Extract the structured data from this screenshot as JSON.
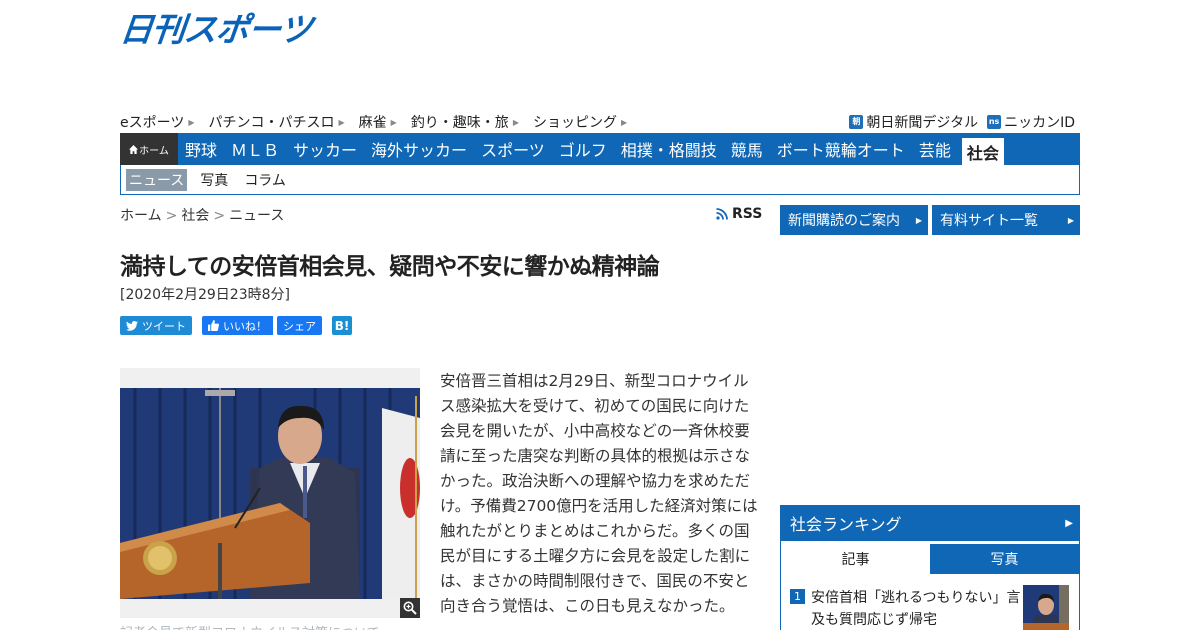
{
  "site": {
    "logo_text": "日刊スポーツ"
  },
  "sublinks": [
    "eスポーツ",
    "パチンコ・パチスロ",
    "麻雀",
    "釣り・趣味・旅",
    "ショッピング"
  ],
  "extlinks": [
    {
      "icon": "朝",
      "label": "朝日新聞デジタル"
    },
    {
      "icon": "ns",
      "label": "ニッカンID"
    }
  ],
  "mainnav": {
    "home_label": "ホーム",
    "items": [
      "野球",
      "ＭＬＢ",
      "サッカー",
      "海外サッカー",
      "スポーツ",
      "ゴルフ",
      "相撲・格闘技",
      "競馬",
      "ボート競輪オート",
      "芸能",
      "社会"
    ],
    "active": "社会"
  },
  "subnav": {
    "items": [
      "ニュース",
      "写真",
      "コラム"
    ],
    "active": "ニュース"
  },
  "breadcrumb": {
    "home": "ホーム",
    "section": "社会",
    "current": "ニュース",
    "sep": ">"
  },
  "rss_label": "RSS",
  "article": {
    "headline": "満持しての安倍首相会見、疑問や不安に響かぬ精神論",
    "date": "[2020年2月29日23時8分]",
    "caption": "記者会見で新型コロナウイルス対策について",
    "body": "安倍晋三首相は2月29日、新型コロナウイルス感染拡大を受けて、初めての国民に向けた会見を開いたが、小中高校などの一斉休校要請に至った唐突な判断の具体的根拠は示さなかった。政治決断への理解や協力を求めただけ。予備費2700億円を活用した経済対策には触れたがとりまとめはこれからだ。多くの国民が目にする土曜夕方に会見を設定した割には、まさかの時間制限付きで、国民の不安と向き合う覚悟は、この日も見えなかった。"
  },
  "share": {
    "tweet": "ツイート",
    "like": "いいね！",
    "share": "シェア",
    "hatena": "B!"
  },
  "sidebar": {
    "subscribe": "新聞購読のご案内",
    "paid_sites": "有料サイト一覧",
    "ranking_title": "社会ランキング",
    "tabs": [
      "記事",
      "写真"
    ],
    "ranking": [
      {
        "rank": "1",
        "title": "安倍首相「逃れるつもりない」言及も質問応じず帰宅"
      }
    ]
  },
  "colors": {
    "brand_blue": "#1067b5",
    "logo_blue": "#0a63b8"
  }
}
